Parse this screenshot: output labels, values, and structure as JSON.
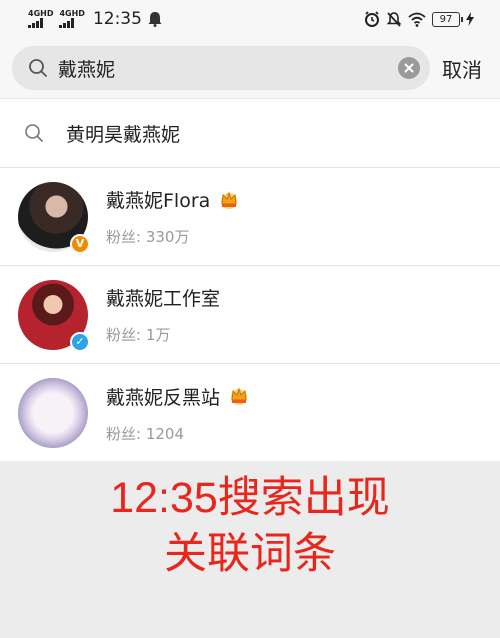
{
  "status_bar": {
    "signal1_label": "4GHD",
    "signal2_label": "4GHD",
    "time": "12:35",
    "battery": "97"
  },
  "search": {
    "query": "戴燕妮",
    "cancel_label": "取消"
  },
  "suggestion": {
    "text": "黄明昊戴燕妮"
  },
  "results": [
    {
      "name": "戴燕妮Flora",
      "fans": "粉丝: 330万",
      "badge": "V",
      "badge_color": "#f08a00",
      "crown": true
    },
    {
      "name": "戴燕妮工作室",
      "fans": "粉丝: 1万",
      "badge": "✓",
      "badge_color": "#2aa4e6",
      "crown": false
    },
    {
      "name": "戴燕妮反黑站",
      "fans": "粉丝: 1204",
      "badge": "",
      "crown": true
    }
  ],
  "caption": {
    "line1": "12:35搜索出现",
    "line2": "关联词条"
  },
  "colors": {
    "caption": "#e8261c",
    "crown": "#f3a11a"
  }
}
